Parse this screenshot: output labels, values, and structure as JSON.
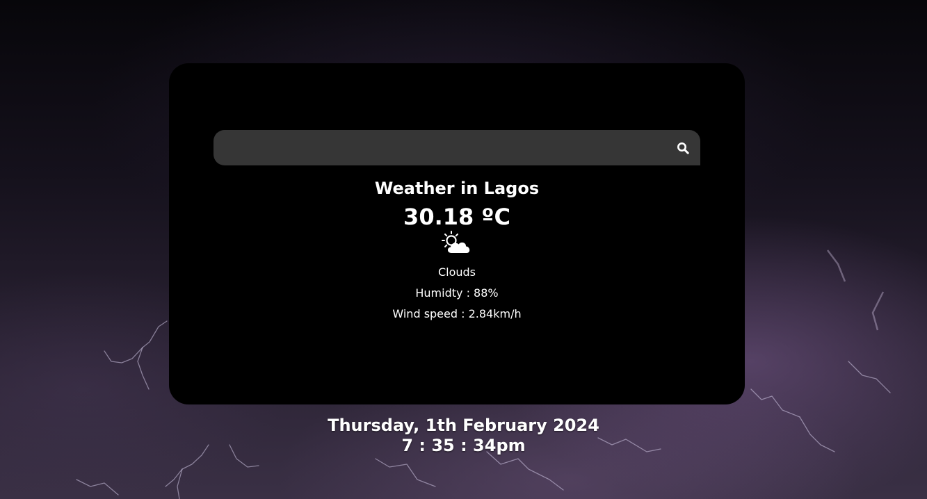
{
  "search": {
    "value": "",
    "placeholder": "",
    "button_icon": "search-icon"
  },
  "weather": {
    "title": "Weather in Lagos",
    "temperature": "30.18 ºC",
    "icon": "partly-cloudy-icon",
    "description": "Clouds",
    "humidity": "Humidty : 88%",
    "wind": "Wind speed : 2.84km/h"
  },
  "datetime": {
    "date": "Thursday, 1th February 2024",
    "time": "7 : 35 : 34pm"
  },
  "colors": {
    "card_background": "#000000",
    "search_background": "#363636",
    "text": "#ffffff"
  },
  "background": {
    "icon": "thunderstorm-lightning-background"
  }
}
